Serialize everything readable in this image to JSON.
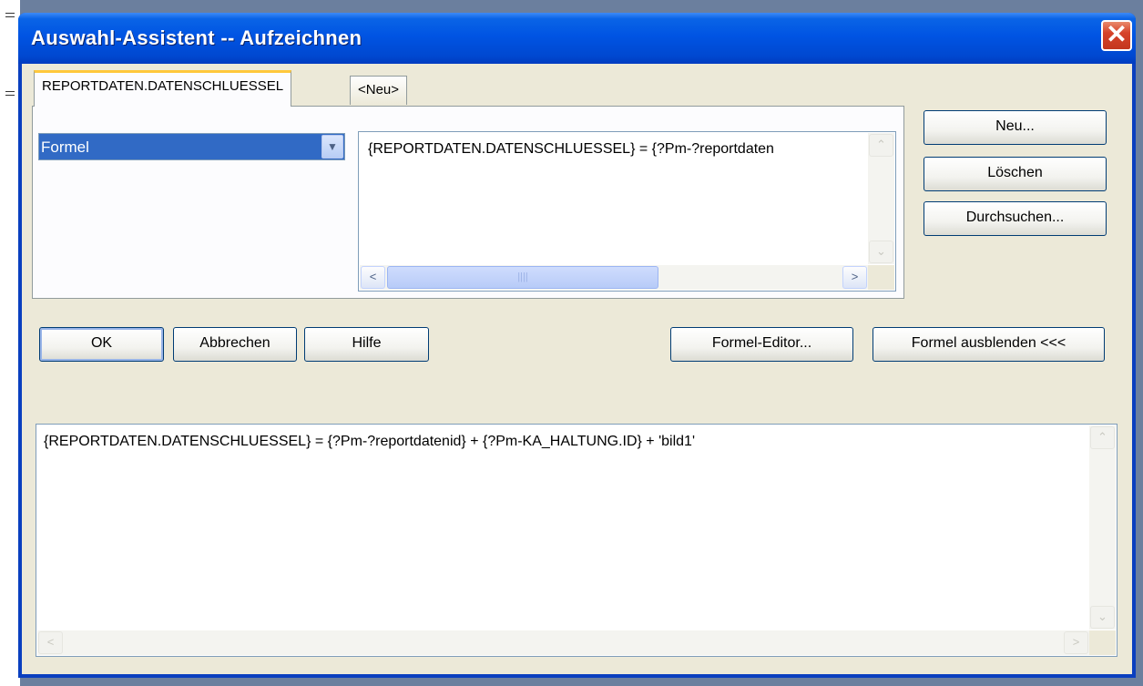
{
  "window": {
    "title": "Auswahl-Assistent -- Aufzeichnen",
    "close_glyph": "✕"
  },
  "tabs": [
    {
      "label": "REPORTDATEN.DATENSCHLUESSEL",
      "active": true
    },
    {
      "label": "<Neu>",
      "active": false
    }
  ],
  "panel": {
    "operator_select": {
      "value": "Formel",
      "icon": "chevron-down-icon"
    },
    "formula_preview": "{REPORTDATEN.DATENSCHLUESSEL} = {?Pm-?reportdaten"
  },
  "side_buttons": {
    "new": "Neu...",
    "delete": "Löschen",
    "browse": "Durchsuchen..."
  },
  "action_buttons": {
    "ok": "OK",
    "cancel": "Abbrechen",
    "help": "Hilfe",
    "formula_editor": "Formel-Editor...",
    "hide_formula": "Formel ausblenden <<<"
  },
  "formula_text": "{REPORTDATEN.DATENSCHLUESSEL} = {?Pm-?reportdatenid} + {?Pm-KA_HALTUNG.ID} + 'bild1'",
  "scroll_glyphs": {
    "up": "⌃",
    "down": "⌄",
    "left": "<",
    "right": ">",
    "grip": "||||"
  },
  "colors": {
    "titlebar": "#0054e3",
    "selection": "#316ac5",
    "client": "#ece9d8",
    "tab_highlight": "#ffc83c"
  }
}
